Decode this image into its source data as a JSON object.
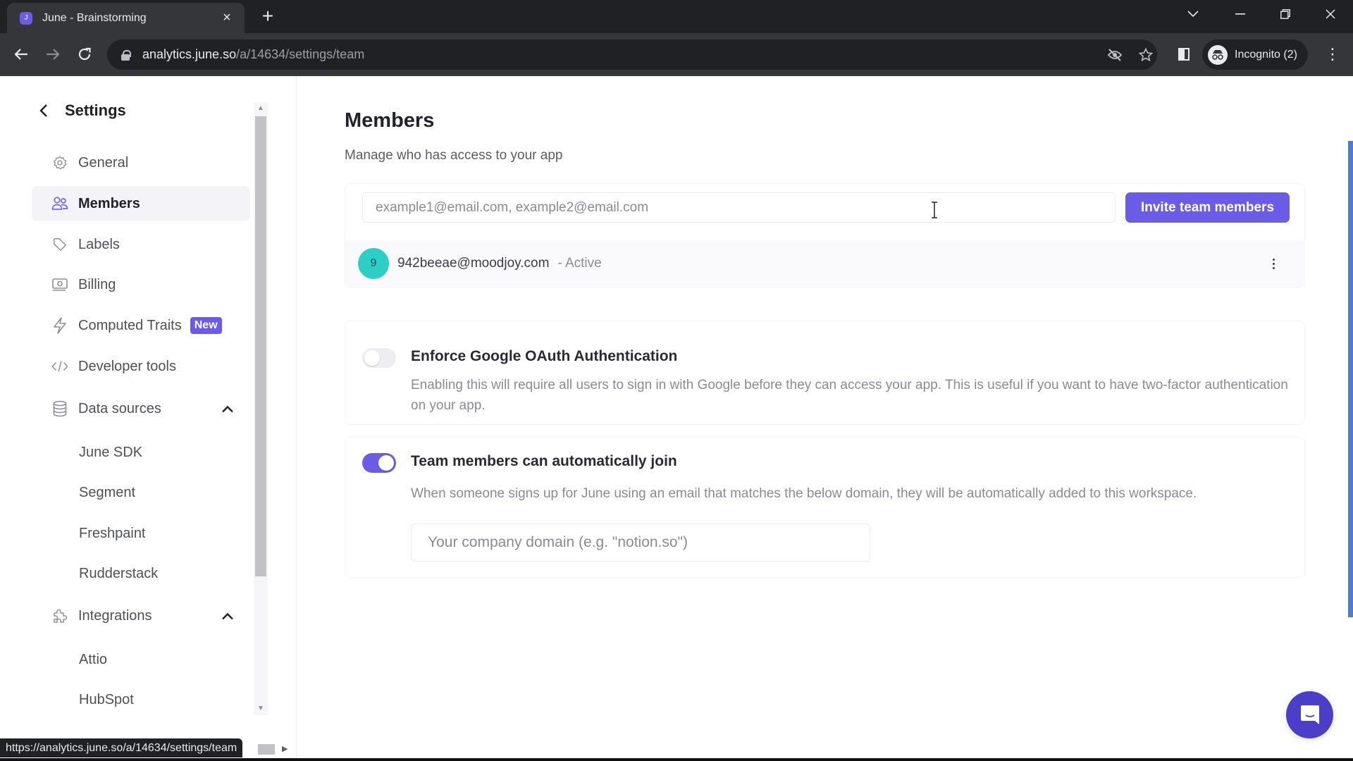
{
  "browser": {
    "tab_title": "June - Brainstorming",
    "favicon_letter": "J",
    "url_host": "analytics.june.so",
    "url_path": "/a/14634/settings/team",
    "profile_label": "Incognito (2)",
    "status_url": "https://analytics.june.so/a/14634/settings/team"
  },
  "sidebar": {
    "title": "Settings",
    "items": [
      {
        "label": "General",
        "icon": "gear-icon"
      },
      {
        "label": "Members",
        "icon": "users-icon",
        "active": true
      },
      {
        "label": "Labels",
        "icon": "tag-icon"
      },
      {
        "label": "Billing",
        "icon": "billing-icon"
      },
      {
        "label": "Computed Traits",
        "icon": "lightning-icon",
        "badge": "New"
      },
      {
        "label": "Developer tools",
        "icon": "code-icon"
      }
    ],
    "data_sources": {
      "label": "Data sources",
      "icon": "database-icon",
      "expanded": true,
      "children": [
        "June SDK",
        "Segment",
        "Freshpaint",
        "Rudderstack"
      ]
    },
    "integrations": {
      "label": "Integrations",
      "icon": "puzzle-icon",
      "expanded": true,
      "children": [
        "Attio",
        "HubSpot"
      ]
    }
  },
  "main": {
    "title": "Members",
    "subtitle": "Manage who has access to your app",
    "invite": {
      "placeholder": "example1@email.com, example2@email.com",
      "value": "",
      "button_label": "Invite team members"
    },
    "members": [
      {
        "avatar_letter": "9",
        "email": "942beeae@moodjoy.com",
        "status": "- Active"
      }
    ],
    "settings": [
      {
        "title": "Enforce Google OAuth Authentication",
        "description": "Enabling this will require all users to sign in with Google before they can access your app. This is useful if you want to have two-factor authentication on your app.",
        "enabled": false
      },
      {
        "title": "Team members can automatically join",
        "description": "When someone signs up for June using an email that matches the below domain, they will be automatically added to this workspace.",
        "enabled": true,
        "domain_placeholder": "Your company domain (e.g. \"notion.so\")",
        "domain_value": ""
      }
    ]
  },
  "colors": {
    "accent": "#6b5ce7",
    "avatar": "#2ccfc6",
    "chat_fab": "#4b3fc9"
  }
}
